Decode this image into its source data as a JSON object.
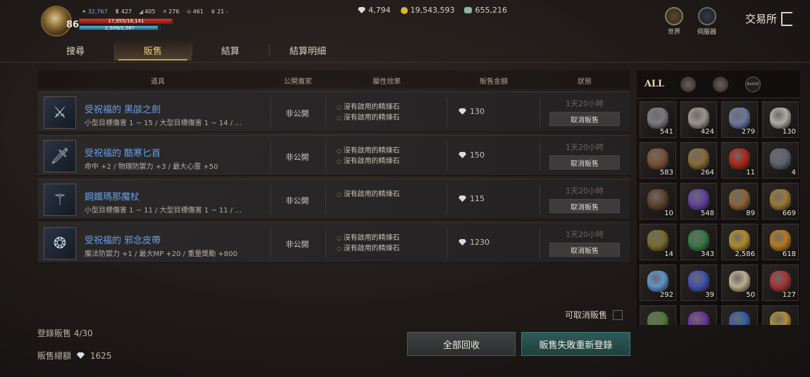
{
  "hud": {
    "level": "86",
    "stats": [
      "32,767",
      "427",
      "405",
      "276",
      "461",
      "21 -"
    ],
    "hp_text": "17,955/18,141",
    "hp_fraction": 0.99,
    "mp_text": "2,509/2,587",
    "mp_fraction": 0.97,
    "currency": {
      "diamonds": "4,794",
      "gold": "19,543,593",
      "gems": "655,216"
    },
    "world_label": "世界",
    "server_label": "伺服器",
    "exchange_title": "交易所"
  },
  "tabs": [
    "搜尋",
    "販售",
    "結算",
    "結算明細"
  ],
  "active_tab": 1,
  "table": {
    "headers": [
      "道具",
      "公開賣家",
      "屬性效果",
      "販售金額",
      "狀態"
    ],
    "rows": [
      {
        "name": "受祝福的 黑燄之劍",
        "desc": "小型目標傷害 1 ~ 15 / 大型目標傷害 1 ~ 14 / ...",
        "buyer": "非公開",
        "attrs": [
          "沒有啟用的精煉石",
          "沒有啟用的精煉石"
        ],
        "price": "130",
        "time": "1天20小時",
        "action": "取消販售",
        "icon": "sword-icon"
      },
      {
        "name": "受祝福的 酷寒匕首",
        "desc": "命中 +2 / 物理防禦力 +3 / 最大心靈 +50",
        "buyer": "非公開",
        "attrs": [
          "沒有啟用的精煉石",
          "沒有啟用的精煉石"
        ],
        "price": "150",
        "time": "1天20小時",
        "action": "取消販售",
        "icon": "dagger-icon"
      },
      {
        "name": "鋼鐵瑪那魔杖",
        "desc": "小型目標傷害 1 ~ 11 / 大型目標傷害 1 ~ 11 / ...",
        "buyer": "非公開",
        "attrs": [
          "沒有啟用的精煉石"
        ],
        "price": "115",
        "time": "1天20小時",
        "action": "取消販售",
        "icon": "staff-icon"
      },
      {
        "name": "受祝福的 邪念皮帶",
        "desc": "魔法防禦力 +1 / 最大MP +20 / 重量獎勵 +800",
        "buyer": "非公開",
        "attrs": [
          "沒有啟用的精煉石",
          "沒有啟用的精煉石"
        ],
        "price": "1230",
        "time": "1天20小時",
        "action": "取消販售",
        "icon": "belt-icon"
      }
    ]
  },
  "footer": {
    "cancel_label": "可取消販售",
    "registered": "登錄販售 4/30",
    "total_label": "販售總額",
    "total_value": "1625",
    "recall_all": "全部回收",
    "relist_failed": "販售失敗重新登錄"
  },
  "inventory": {
    "tabs": [
      "ALL",
      "helmet",
      "bag",
      "Assist"
    ],
    "assist_label": "Assist",
    "slots": [
      {
        "qty": "541",
        "color": "#8a8a92"
      },
      {
        "qty": "424",
        "color": "#b0aaa0"
      },
      {
        "qty": "279",
        "color": "#7a8ab8"
      },
      {
        "qty": "130",
        "color": "#c8c4bc"
      },
      {
        "qty": "583",
        "color": "#8a5a3a"
      },
      {
        "qty": "264",
        "color": "#9a7a3a"
      },
      {
        "qty": "11",
        "color": "#c22a1a"
      },
      {
        "qty": "4",
        "color": "#6a7080"
      },
      {
        "qty": "10",
        "color": "#6a4a30"
      },
      {
        "qty": "548",
        "color": "#6a4ab8"
      },
      {
        "qty": "89",
        "color": "#a07040"
      },
      {
        "qty": "669",
        "color": "#b08a3a"
      },
      {
        "qty": "14",
        "color": "#8a7a30"
      },
      {
        "qty": "343",
        "color": "#3a8a4a"
      },
      {
        "qty": "2,586",
        "color": "#c8a030"
      },
      {
        "qty": "618",
        "color": "#d08a20"
      },
      {
        "qty": "292",
        "color": "#6aa8e8"
      },
      {
        "qty": "39",
        "color": "#4a5ac8"
      },
      {
        "qty": "50",
        "color": "#d8c8a0"
      },
      {
        "qty": "127",
        "color": "#b83a3a"
      },
      {
        "qty": "",
        "color": "#5a8a3a"
      },
      {
        "qty": "",
        "color": "#7a3aa8"
      },
      {
        "qty": "",
        "color": "#3a6ab8"
      },
      {
        "qty": "",
        "color": "#c8a040"
      }
    ]
  }
}
